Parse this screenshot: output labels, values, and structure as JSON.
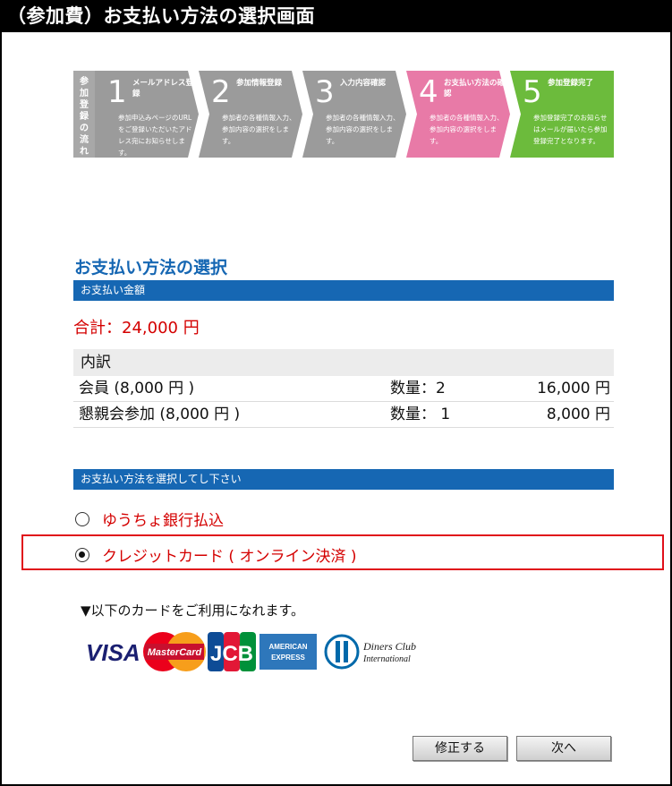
{
  "window": {
    "title": "（参加費）お支払い方法の選択画面"
  },
  "flow": {
    "header": [
      "参",
      "加",
      "登",
      "録",
      "の",
      "流",
      "れ"
    ],
    "steps": [
      {
        "num": "1",
        "title": "メールアドレス登録",
        "desc": "参加申込みページのURLをご登録いただいたアドレス宛にお知らせします。",
        "color": "#9b9b9b"
      },
      {
        "num": "2",
        "title": "参加情報登録",
        "desc": "参加者の各種情報入力、参加内容の選択をします。",
        "color": "#9b9b9b"
      },
      {
        "num": "3",
        "title": "入力内容確認",
        "desc": "参加者の各種情報入力、参加内容の選択をします。",
        "color": "#9b9b9b"
      },
      {
        "num": "4",
        "title": "お支払い方法の確認",
        "desc": "参加者の各種情報入力、参加内容の選択をします。",
        "color": "#e87aa7"
      },
      {
        "num": "5",
        "title": "参加登録完了",
        "desc": "参加登録完了のお知らせはメールが届いたら参加登録完了となります。",
        "color": "#6cbb3c"
      }
    ]
  },
  "payment": {
    "title": "お支払い方法の選択",
    "amount_bar": "お支払い金額",
    "total": "合計：24,000 円",
    "breakdown": {
      "header": "内訳",
      "rows": [
        {
          "item": "会員 (8,000 円 )",
          "qty": "数量：2",
          "amount": "16,000 円"
        },
        {
          "item": "懇親会参加 (8,000 円 )",
          "qty": "数量： 1",
          "amount": "8,000 円"
        }
      ]
    },
    "method_bar": "お支払い方法を選択してし下さい",
    "options": [
      {
        "label": "ゆうちょ銀行払込",
        "selected": false
      },
      {
        "label": "クレジットカード ( オンライン決済 )",
        "selected": true
      }
    ],
    "cards_note": "▼以下のカードをご利用になれます。",
    "card_logos": {
      "visa": "VISA",
      "mastercard": "MasterCard",
      "jcb": "JCB",
      "amex_top": "AMERICAN",
      "amex_bottom": "EXPRESS",
      "diners_top": "Diners Club",
      "diners_bottom": "International"
    }
  },
  "buttons": {
    "edit": "修正する",
    "next": "次へ"
  }
}
